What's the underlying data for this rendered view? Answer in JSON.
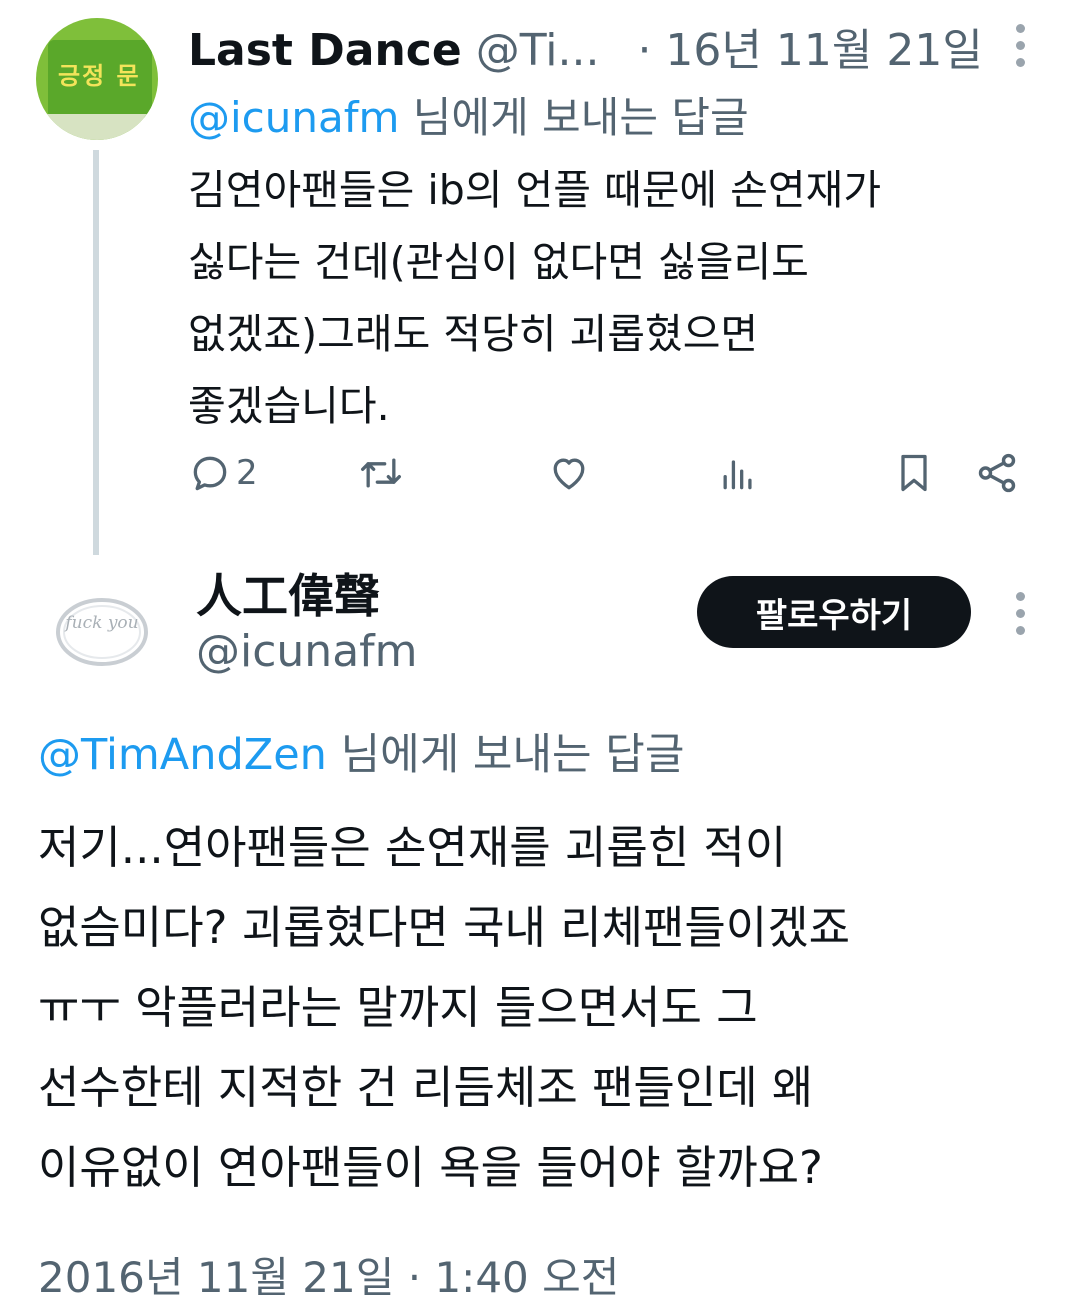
{
  "reply": {
    "display_name": "Last Dance",
    "handle": "@Ti...",
    "date": "· 16년 11월 21일",
    "replying_to": {
      "mention": "@icunafm",
      "suffix": " 님에게 보내는 답글"
    },
    "body_lines": [
      "김연아팬들은 ib의 언플 때문에 손연재가",
      "싫다는 건데(관심이 없다면 싫을리도",
      "없겠죠)그래도 적당히 괴롭혔으면",
      "좋겠습니다."
    ],
    "actions": {
      "reply_count": "2"
    },
    "avatar_text": "긍정 문"
  },
  "main": {
    "display_name": "人工偉聲",
    "handle": "@icunafm",
    "follow_label": "팔로우하기",
    "avatar_text": "fuck you",
    "replying_to": {
      "mention": "@TimAndZen",
      "suffix": " 님에게 보내는 답글"
    },
    "body_lines": [
      "저기...연아팬들은 손연재를 괴롭힌 적이",
      "없슴미다? 괴롭혔다면 국내 리체팬들이겠죠",
      "ㅠㅜ 악플러라는 말까지 들으면서도  그",
      "선수한테 지적한 건 리듬체조 팬들인데 왜",
      "이유없이 연아팬들이 욕을 들어야 할까요?"
    ],
    "timestamp": "2016년 11월 21일 · 1:40 오전"
  },
  "colors": {
    "text": "#0f1419",
    "secondary": "#536471",
    "link": "#1d9bf0",
    "thread_line": "#cfd9de",
    "button_bg": "#0f1419"
  }
}
